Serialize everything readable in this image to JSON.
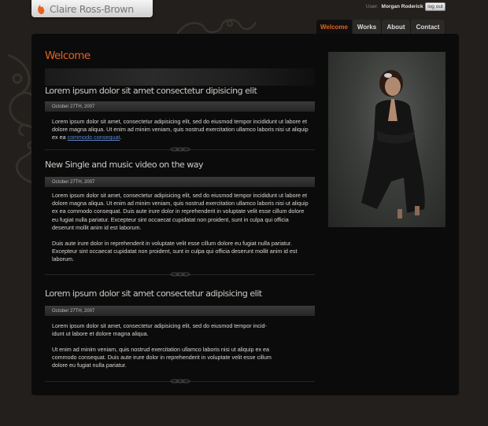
{
  "site": {
    "logo_text": "Claire Ross-Brown"
  },
  "user": {
    "label": "User:",
    "name": "Morgan Roderick",
    "logout_label": "log out"
  },
  "nav": {
    "tabs": [
      "Welcome",
      "Works",
      "About",
      "Contact"
    ],
    "active": "Welcome"
  },
  "page": {
    "title": "Welcome"
  },
  "posts": [
    {
      "title": "Lorem ipsum dolor sit amet consectetur dipisicing elit",
      "date": "October 27TH, 2007",
      "paragraphs": [
        "Lorem ipsum dolor sit amet, consectetur adipisicing elit, sed do eiusmod tempor incididunt ut labore et dolore magna aliqua. Ut enim ad minim veniam, quis nostrud exercitation ullamco laboris nisi ut aliquip ex ea"
      ],
      "link_text": "commodo consequat",
      "link_tail": "."
    },
    {
      "title": "New Single and music video on the way",
      "date": "October 27TH, 2007",
      "paragraphs": [
        "Lorem ipsum dolor sit amet, consectetur adipisicing elit, sed do eiusmod tempor incididunt ut labore et dolore magna aliqua. Ut enim ad minim veniam, quis nostrud exercitation ullamco laboris nisi ut aliquip ex ea commodo consequat. Duis aute irure dolor in reprehenderit in voluptate velit esse cillum dolore eu fugiat nulla pariatur. Excepteur sint occaecat cupidatat non proident, sunt in culpa qui officia deserunt mollit anim id est laborum.",
        "Duis aute irure dolor in reprehenderit in voluptate velit esse cillum dolore eu fugiat nulla pariatur. Excepteur sint occaecat cupidatat non proident, sunt in culpa qui officia deserunt mollit anim id est laborum."
      ]
    },
    {
      "title": "Lorem ipsum dolor sit amet consectetur adipisicing elit",
      "date": "October 27TH, 2007",
      "paragraphs": [
        "Lorem ipsum dolor sit amet, consectetur adipisicing elit, sed do eiusmod tempor incid-idunt ut labore et dolore magna aliqua.",
        "Ut enim ad minim veniam, quis nostrud exercitation ullamco laboris nisi ut aliquip ex ea commodo consequat. Duis aute irure dolor in reprehenderit in voluptate velit esse cillum dolore eu fugiat nulla pariatur."
      ]
    }
  ],
  "colors": {
    "accent": "#e8621f",
    "background": "#231f1c",
    "panel": "#0b0b0b",
    "link": "#5a86c8"
  },
  "icons": {
    "logo_mark": "flame-logo-icon",
    "divider": "ornament-divider-icon"
  }
}
